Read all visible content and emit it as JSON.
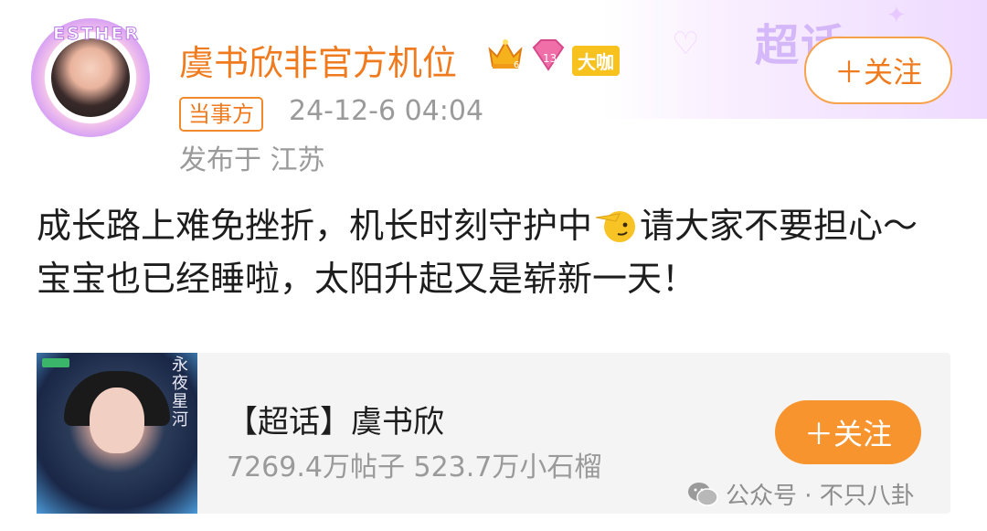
{
  "header_decoration": {
    "chaohua_text": "超话"
  },
  "author": {
    "avatar_text": "ESTHER",
    "name": "虞书欣非官方机位",
    "badge_level": "13",
    "badge_daka": "大咖"
  },
  "meta": {
    "role_tag": "当事方",
    "time": "24-12-6 04:04",
    "location": "发布于 江苏"
  },
  "buttons": {
    "follow_top": "＋关注",
    "follow_card": "＋关注"
  },
  "post": {
    "text_part1": "成长路上难免挫折，机长时刻守护中",
    "text_part2": "请大家不要担心～ 宝宝也已经睡啦，太阳升起又是崭新一天！"
  },
  "topic_card": {
    "title": "【超话】虞书欣",
    "stats": "7269.4万帖子 523.7万小石榴",
    "cover_title": "永夜星河"
  },
  "watermark": {
    "text": "公众号 · 不只八卦"
  },
  "colors": {
    "accent_orange": "#f07b1f",
    "button_orange": "#f7942d",
    "meta_gray": "#9a9a9a"
  }
}
